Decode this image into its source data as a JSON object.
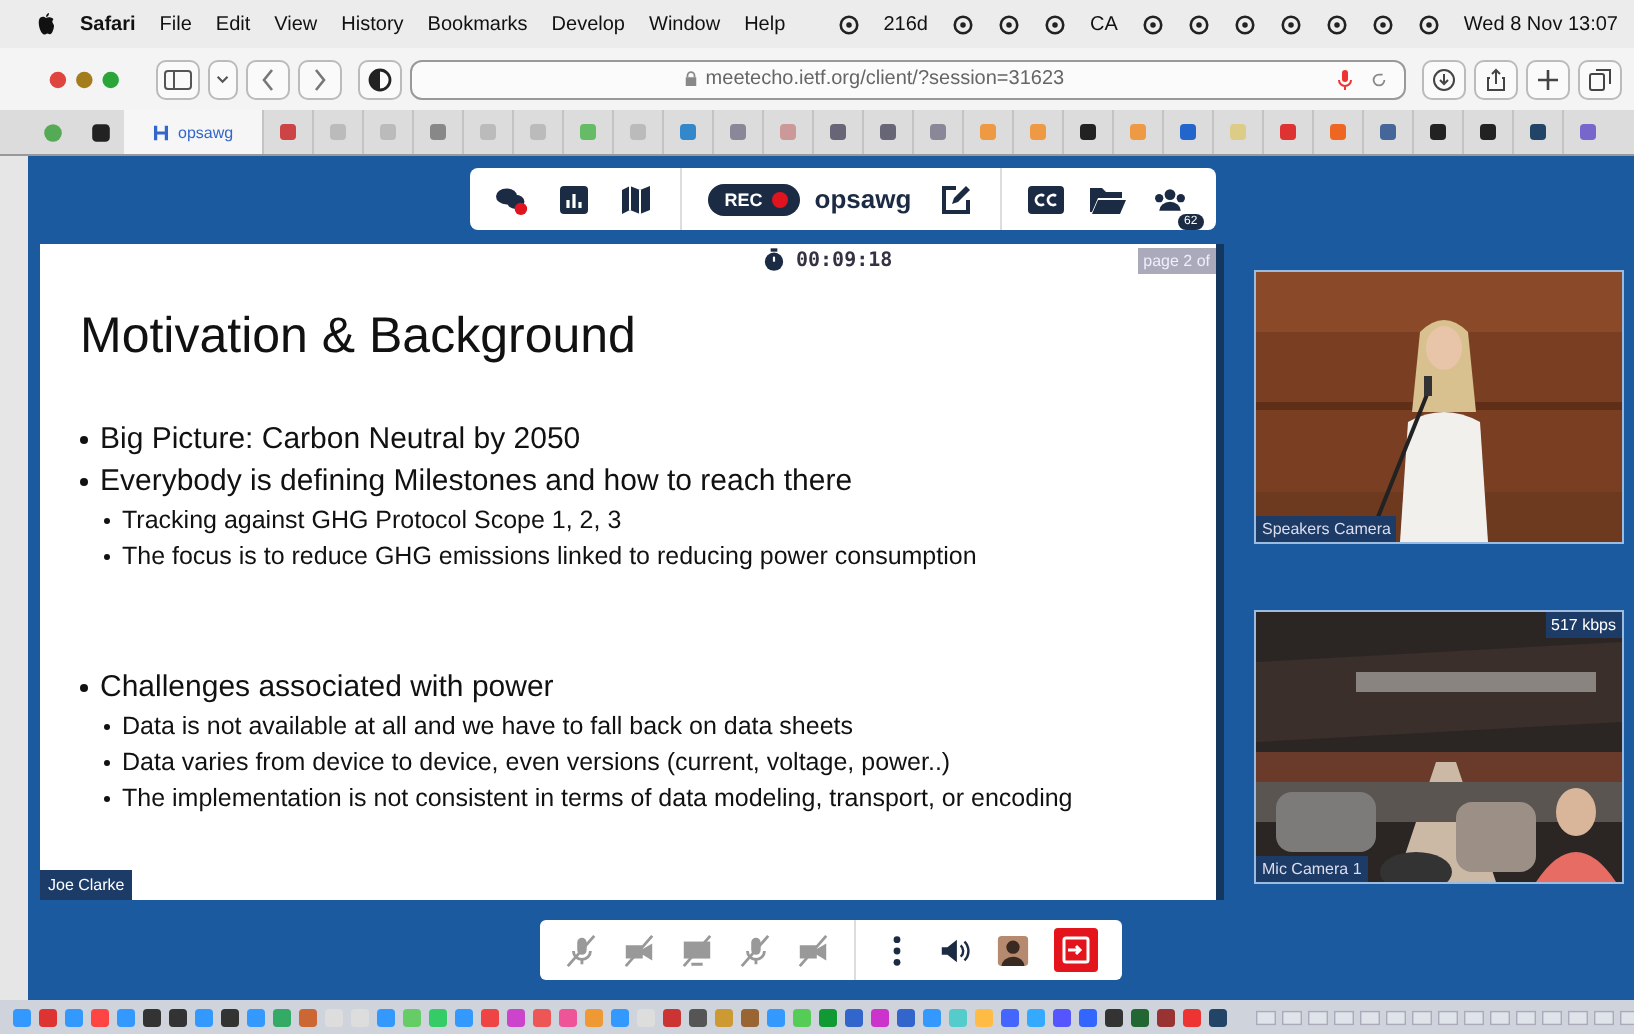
{
  "menubar": {
    "app": "Safari",
    "menus": [
      "File",
      "Edit",
      "View",
      "History",
      "Bookmarks",
      "Develop",
      "Window",
      "Help"
    ],
    "status": [
      {
        "kind": "icon"
      },
      {
        "kind": "text",
        "text": "216d"
      },
      {
        "kind": "icon"
      },
      {
        "kind": "icon"
      },
      {
        "kind": "icon"
      },
      {
        "kind": "text",
        "text": "CA"
      },
      {
        "kind": "icon"
      },
      {
        "kind": "icon"
      },
      {
        "kind": "icon"
      },
      {
        "kind": "icon"
      },
      {
        "kind": "icon"
      },
      {
        "kind": "icon"
      },
      {
        "kind": "icon"
      }
    ],
    "clock": "Wed 8 Nov 13:07"
  },
  "browser": {
    "url": "meetecho.ietf.org/client/?session=31623",
    "tab": {
      "title": "opsawg",
      "selected": true
    }
  },
  "meeting_toolbar": {
    "recording": true,
    "rec_label": "REC",
    "room": "opsawg",
    "chat_unread": true,
    "participants_badge": "62"
  },
  "timer": "00:09:18",
  "slide": {
    "page": "page 2 of",
    "title": "Motivation & Background",
    "bullet_groups": [
      [
        {
          "text": "Big Picture: Carbon Neutral by 2050"
        },
        {
          "text": "Everybody is defining Milestones and how to reach there",
          "children": [
            {
              "text": "Tracking against GHG Protocol Scope 1, 2, 3"
            },
            {
              "text": "The focus is to reduce GHG emissions linked to reducing power consumption"
            }
          ]
        }
      ],
      [
        {
          "text": "Challenges associated with power",
          "children": [
            {
              "text": "Data is not available at all and we have to fall back on data sheets"
            },
            {
              "text": "Data varies from device to device, even versions (current, voltage, power..)"
            },
            {
              "text": "The implementation is not consistent in terms of data modeling, transport, or encoding"
            }
          ]
        }
      ]
    ],
    "presenter": "Joe Clarke"
  },
  "videos": [
    {
      "kind": "speaker",
      "label": "Speakers Camera"
    },
    {
      "kind": "room",
      "label": "Mic Camera 1",
      "bitrate": "517 kbps"
    }
  ],
  "controls": [
    {
      "kind": "mic",
      "disabled": true
    },
    {
      "kind": "camera",
      "disabled": true
    },
    {
      "kind": "screen",
      "disabled": true
    },
    {
      "kind": "mic",
      "disabled": true
    },
    {
      "kind": "camera",
      "disabled": true
    },
    {
      "kind": "more",
      "disabled": false
    },
    {
      "kind": "volume",
      "disabled": false
    },
    {
      "kind": "avatar",
      "disabled": false
    },
    {
      "kind": "leave",
      "disabled": false
    }
  ]
}
